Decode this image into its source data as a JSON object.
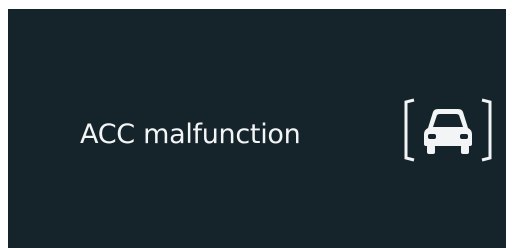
{
  "alert": {
    "message": "ACC malfunction",
    "icon": "adaptive-cruise-control-car-icon"
  },
  "colors": {
    "panel_background": "#14242a",
    "text": "#f2f4f5",
    "page_background": "#ffffff"
  }
}
